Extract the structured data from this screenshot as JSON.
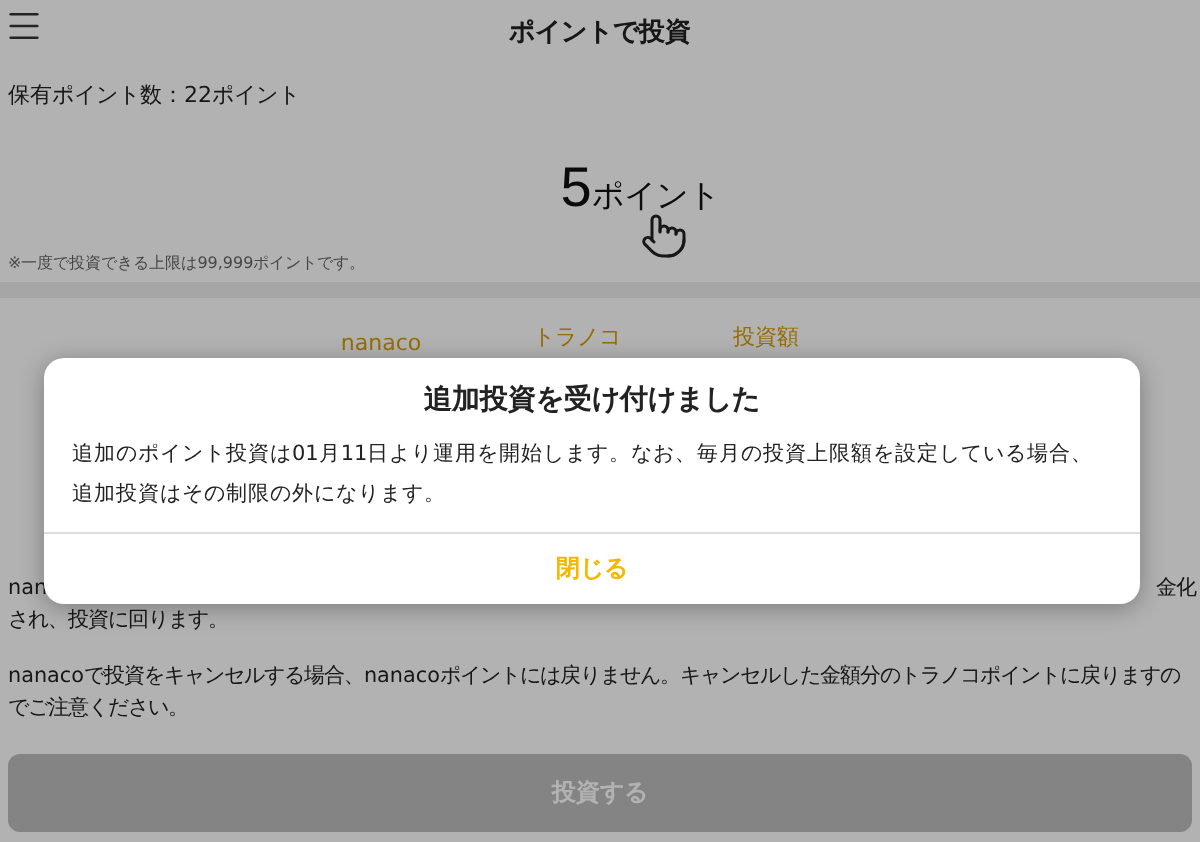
{
  "header": {
    "title": "ポイントで投資"
  },
  "holding": "保有ポイント数：22ポイント",
  "amount": {
    "number": "5",
    "unit": "ポイント"
  },
  "note": "※一度で投資できる上限は99,999ポイントです。",
  "columns": [
    "nanaco",
    "トラノコ",
    "投資額"
  ],
  "paragraph_1": {
    "start": "nan",
    "end": "金化",
    "line_2": "され、投資に回ります。"
  },
  "paragraph_2": "nanacoで投資をキャンセルする場合、nanacoポイントには戻りません。キャンセルした金額分のトラノコポイントに戻りますのでご注意ください。",
  "invest_button": {
    "label": "投資する",
    "disabled": true
  },
  "dialog": {
    "title": "追加投資を受け付けました",
    "body": "追加のポイント投資は01月11日より運用を開始します。なお、毎月の投資上限額を設定している場合、追加投資はその制限の外になります。",
    "close": "閉じる"
  }
}
